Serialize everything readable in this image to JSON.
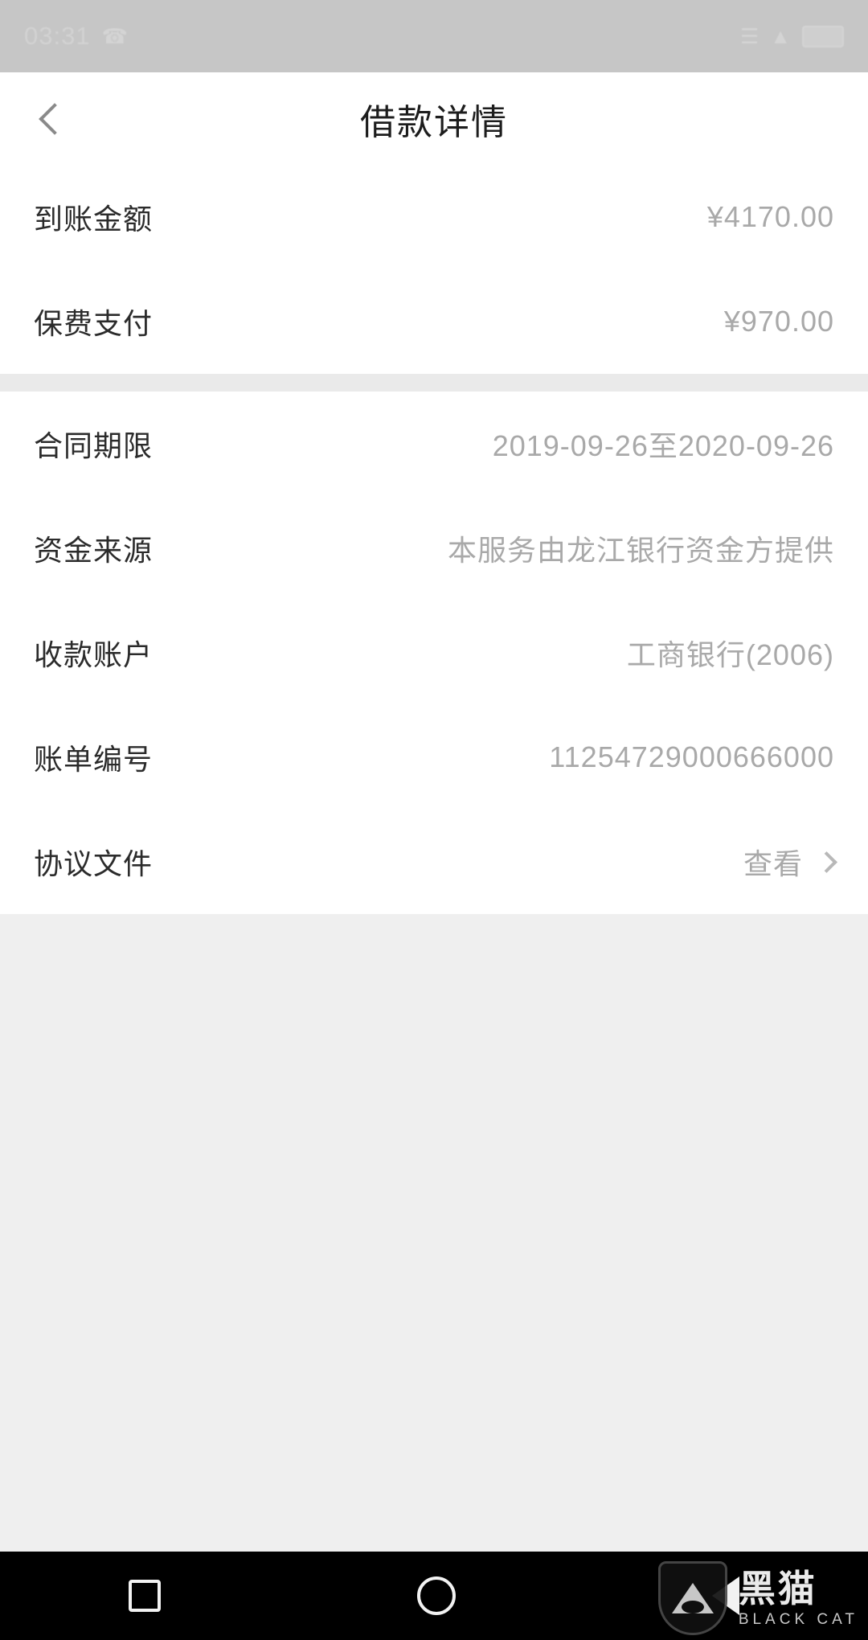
{
  "statusbar": {
    "time": "03:31",
    "left_icon": "phone-call-icon",
    "signal_icon": "signal-icon",
    "wifi_icon": "wifi-icon",
    "battery_icon": "battery-icon"
  },
  "header": {
    "back_icon": "chevron-left-icon",
    "title": "借款详情"
  },
  "cards": [
    {
      "rows": [
        {
          "label": "到账金额",
          "value": "¥4170.00",
          "chevron": false
        },
        {
          "label": "保费支付",
          "value": "¥970.00",
          "chevron": false
        }
      ]
    },
    {
      "rows": [
        {
          "label": "合同期限",
          "value": "2019-09-26至2020-09-26",
          "chevron": false
        },
        {
          "label": "资金来源",
          "value": "本服务由龙江银行资金方提供",
          "chevron": false
        },
        {
          "label": "收款账户",
          "value": "工商银行(2006)",
          "chevron": false
        },
        {
          "label": "账单编号",
          "value": "11254729000666000",
          "chevron": false
        },
        {
          "label": "协议文件",
          "value": "查看",
          "chevron": true
        }
      ]
    }
  ],
  "navbar": {
    "recent_icon": "square-icon",
    "home_icon": "circle-icon",
    "back_icon": "triangle-back-icon"
  },
  "watermark": {
    "logo_icon": "black-cat-logo-icon",
    "name_cn": "黑猫",
    "name_en": "BLACK CAT"
  },
  "colors": {
    "status_bar_bg": "#c6c6c6",
    "card_bg": "#ffffff",
    "page_bg": "#efefef",
    "label": "#2b2b2b",
    "value": "#a9a9a9",
    "navbar_bg": "#000000"
  }
}
